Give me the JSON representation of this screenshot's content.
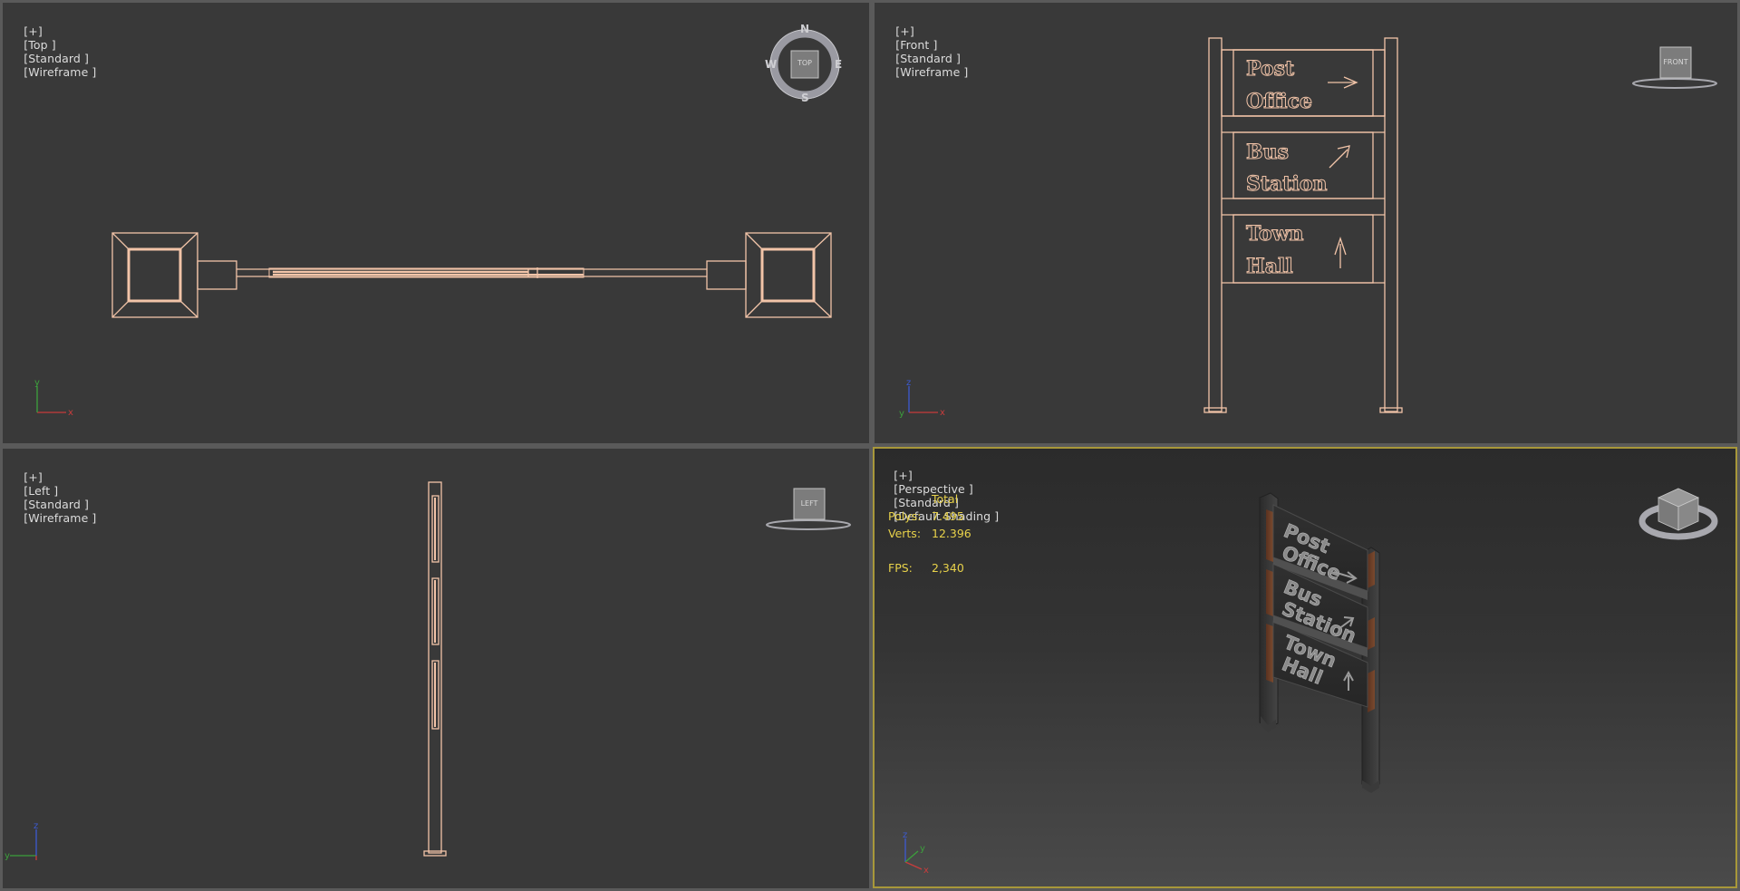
{
  "viewports": {
    "top": {
      "labels": [
        "[+]",
        "[Top ]",
        "[Standard ]",
        "[Wireframe ]"
      ],
      "cube_label": "TOP",
      "compass": {
        "n": "N",
        "s": "S",
        "e": "E",
        "w": "W"
      }
    },
    "front": {
      "labels": [
        "[+]",
        "[Front ]",
        "[Standard ]",
        "[Wireframe ]"
      ],
      "cube_label": "FRONT"
    },
    "left": {
      "labels": [
        "[+]",
        "[Left ]",
        "[Standard ]",
        "[Wireframe ]"
      ],
      "cube_label": "LEFT"
    },
    "perspective": {
      "labels": [
        "[+]",
        "[Perspective ]",
        "[Standard ]",
        "[Default Shading ]"
      ]
    }
  },
  "stats": {
    "header": "Total",
    "polys_label": "Polys:",
    "polys_value": "7.495",
    "verts_label": "Verts:",
    "verts_value": "12.396",
    "fps_label": "FPS:",
    "fps_value": "2,340"
  },
  "sign": {
    "lines": [
      [
        "Post",
        "Office"
      ],
      [
        "Bus",
        "Station"
      ],
      [
        "Town",
        "Hall"
      ]
    ]
  },
  "axes": {
    "top": {
      "u": "x",
      "v": "y"
    },
    "front": {
      "u": "x",
      "v": "z",
      "w": "y"
    },
    "left": {
      "u": "y",
      "v": "z"
    },
    "persp": {
      "u": "x",
      "v": "z",
      "w": "y"
    }
  },
  "colors": {
    "wire": "#f2c4a8",
    "viewport_bg": "#393939",
    "active_border": "#a8983a",
    "stats": "#e8d24a"
  }
}
